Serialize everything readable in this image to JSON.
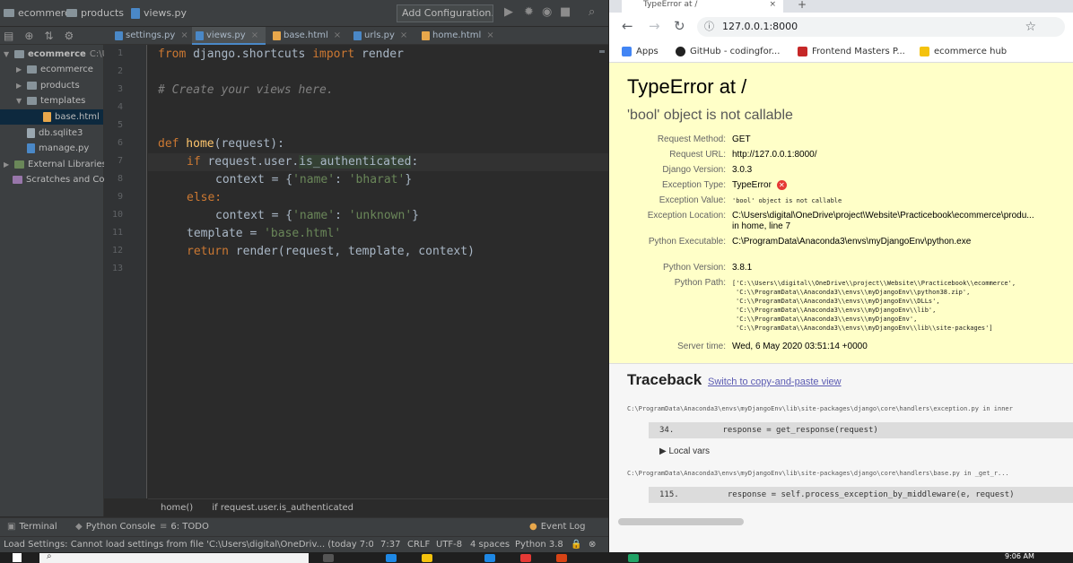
{
  "ide": {
    "breadcrumbs": [
      "ecommerce",
      "products",
      "views.py"
    ],
    "add_config_label": "Add Configuration...",
    "tabs": [
      {
        "label": "settings.py",
        "active": false,
        "color": "#4a88c7"
      },
      {
        "label": "views.py",
        "active": true,
        "color": "#4a88c7"
      },
      {
        "label": "base.html",
        "active": false,
        "color": "#e8a74b"
      },
      {
        "label": "urls.py",
        "active": false,
        "color": "#4a88c7"
      },
      {
        "label": "home.html",
        "active": false,
        "color": "#e8a74b"
      }
    ],
    "project_tree": [
      {
        "label": "ecommerce",
        "suffix": "C:\\U",
        "type": "folder",
        "expanded": true,
        "depth": 0
      },
      {
        "label": "ecommerce",
        "type": "folder",
        "expanded": false,
        "depth": 1
      },
      {
        "label": "products",
        "type": "folder",
        "expanded": false,
        "depth": 1
      },
      {
        "label": "templates",
        "type": "folder",
        "expanded": true,
        "depth": 1
      },
      {
        "label": "base.html",
        "type": "html",
        "depth": 2,
        "selected": true
      },
      {
        "label": "db.sqlite3",
        "type": "db",
        "depth": 1
      },
      {
        "label": "manage.py",
        "type": "py",
        "depth": 1
      },
      {
        "label": "External Libraries",
        "type": "lib",
        "expanded": false,
        "depth": 0
      },
      {
        "label": "Scratches and Co",
        "type": "scr",
        "depth": 0
      }
    ],
    "line_numbers": [
      "1",
      "2",
      "3",
      "4",
      "5",
      "6",
      "7",
      "8",
      "9",
      "10",
      "11",
      "12",
      "13"
    ],
    "code": {
      "l1_from": "from",
      "l1_mod": " django.shortcuts ",
      "l1_import": "import",
      "l1_name": " render",
      "l3": "# Create your views here.",
      "l6_def": "def",
      "l6_name": " home",
      "l6_rest": "(request):",
      "l7_if": "if",
      "l7_rest": " request.user.",
      "l7_hl": "is_authenticated",
      "l7_end": ":",
      "l8_pre": "context = {",
      "l8_key": "'name'",
      "l8_mid": ": ",
      "l8_val": "'bharat'",
      "l8_end": "}",
      "l9_else": "else:",
      "l10_pre": "context = {",
      "l10_key": "'name'",
      "l10_mid": ": ",
      "l10_val": "'unknown'",
      "l10_end": "}",
      "l11_pre": "template = ",
      "l11_val": "'base.html'",
      "l12_ret": "return",
      "l12_rest": " render(request, template, context)"
    },
    "editor_breadcrumb": [
      "home()",
      "if request.user.is_authenticated"
    ],
    "tool_tabs": [
      "Terminal",
      "Python Console",
      "6: TODO",
      "Event Log"
    ],
    "status": {
      "message": "Load Settings: Cannot load settings from file 'C:\\Users\\digital\\OneDriv... (today 7:01 AM)",
      "position": "7:37",
      "line_sep": "CRLF",
      "encoding": "UTF-8",
      "indent": "4 spaces",
      "interpreter": "Python 3.8"
    }
  },
  "browser": {
    "tab_title": "TypeError at /",
    "url": "127.0.0.1:8000",
    "bookmarks": [
      "Apps",
      "GitHub - codingfor...",
      "Frontend Masters P...",
      "ecommerce hub"
    ],
    "error": {
      "title": "TypeError at /",
      "message": "'bool' object is not callable",
      "rows": [
        {
          "label": "Request Method:",
          "value": "GET"
        },
        {
          "label": "Request URL:",
          "value": "http://127.0.0.1:8000/"
        },
        {
          "label": "Django Version:",
          "value": "3.0.3"
        },
        {
          "label": "Exception Type:",
          "value": "TypeError"
        },
        {
          "label": "Exception Value:",
          "value": "'bool' object is not callable"
        },
        {
          "label": "Exception Location:",
          "value": "C:\\Users\\digital\\OneDrive\\project\\Website\\Practicebook\\ecommerce\\produ..."
        },
        {
          "label": "Python Executable:",
          "value": "C:\\ProgramData\\Anaconda3\\envs\\myDjangoEnv\\python.exe"
        },
        {
          "label": "Python Version:",
          "value": "3.8.1"
        },
        {
          "label": "Python Path:",
          "value": "['C:\\\\Users\\\\digital\\\\OneDrive\\\\project\\\\Website\\\\Practicebook\\\\ecommerce',"
        },
        {
          "label": "Server time:",
          "value": "Wed, 6 May 2020 03:51:14 +0000"
        }
      ],
      "location_line2": "in home, line 7",
      "python_path_lines": [
        "'C:\\\\ProgramData\\\\Anaconda3\\\\envs\\\\myDjangoEnv\\\\python38.zip',",
        "'C:\\\\ProgramData\\\\Anaconda3\\\\envs\\\\myDjangoEnv\\\\DLLs',",
        "'C:\\\\ProgramData\\\\Anaconda3\\\\envs\\\\myDjangoEnv\\\\lib',",
        "'C:\\\\ProgramData\\\\Anaconda3\\\\envs\\\\myDjangoEnv',",
        "'C:\\\\ProgramData\\\\Anaconda3\\\\envs\\\\myDjangoEnv\\\\lib\\\\site-packages']"
      ]
    },
    "traceback": {
      "title": "Traceback",
      "switch_link": "Switch to copy-and-paste view",
      "frames": [
        {
          "path": "C:\\ProgramData\\Anaconda3\\envs\\myDjangoEnv\\lib\\site-packages\\django\\core\\handlers\\exception.py in inner",
          "line_no": "34.",
          "code": "response = get_response(request)",
          "local_vars": "▶ Local vars"
        },
        {
          "path": "C:\\ProgramData\\Anaconda3\\envs\\myDjangoEnv\\lib\\site-packages\\django\\core\\handlers\\base.py in _get_r...",
          "line_no": "115.",
          "code": "response = self.process_exception_by_middleware(e, request)",
          "local_vars": ""
        }
      ]
    }
  },
  "taskbar": {
    "time": "9:06 AM"
  }
}
